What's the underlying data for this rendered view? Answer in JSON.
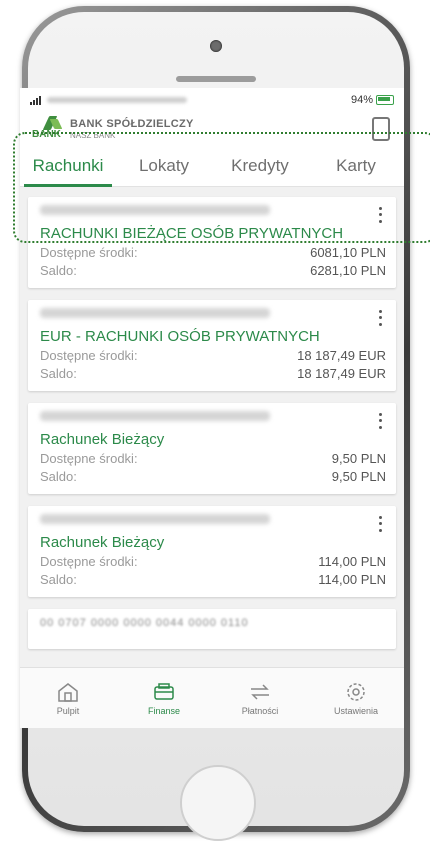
{
  "status_bar": {
    "battery": "94%"
  },
  "bank": {
    "name_line1": "BANK SPÓŁDZIELCZY",
    "name_line2": "NASZ BANK",
    "logo_word": "BANK"
  },
  "tabs": [
    {
      "label": "Rachunki",
      "active": true
    },
    {
      "label": "Lokaty",
      "active": false
    },
    {
      "label": "Kredyty",
      "active": false
    },
    {
      "label": "Karty",
      "active": false
    }
  ],
  "accounts": [
    {
      "name": "RACHUNKI BIEŻĄCE OSÓB PRYWATNYCH",
      "available_label": "Dostępne środki:",
      "available": "6081,10 PLN",
      "balance_label": "Saldo:",
      "balance": "6281,10 PLN"
    },
    {
      "name": "EUR - RACHUNKI OSÓB PRYWATNYCH",
      "available_label": "Dostępne środki:",
      "available": "18 187,49 EUR",
      "balance_label": "Saldo:",
      "balance": "18 187,49 EUR"
    },
    {
      "name": "Rachunek Bieżący",
      "available_label": "Dostępne środki:",
      "available": "9,50 PLN",
      "balance_label": "Saldo:",
      "balance": "9,50 PLN"
    },
    {
      "name": "Rachunek Bieżący",
      "available_label": "Dostępne środki:",
      "available": "114,00 PLN",
      "balance_label": "Saldo:",
      "balance": "114,00 PLN"
    }
  ],
  "partial_account_number": "00 0707 0000 0000 0044 0000 0110",
  "bottom_nav": [
    {
      "label": "Pulpit",
      "icon": "home-icon",
      "active": false
    },
    {
      "label": "Finanse",
      "icon": "wallet-icon",
      "active": true
    },
    {
      "label": "Płatności",
      "icon": "transfer-icon",
      "active": false
    },
    {
      "label": "Ustawienia",
      "icon": "gear-icon",
      "active": false
    }
  ],
  "colors": {
    "accent": "#2c8a4a",
    "highlight": "#2f7d2f"
  }
}
